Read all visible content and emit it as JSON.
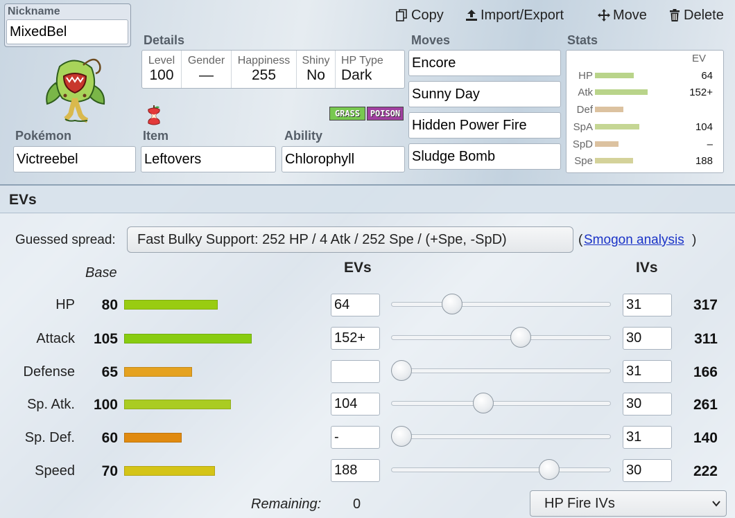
{
  "toolbar": {
    "copy_label": "Copy",
    "import_export_label": "Import/Export",
    "move_label": "Move",
    "delete_label": "Delete"
  },
  "nickname": {
    "label": "Nickname",
    "value": "MixedBel"
  },
  "details": {
    "label": "Details",
    "level": {
      "label": "Level",
      "value": "100"
    },
    "gender": {
      "label": "Gender",
      "value": "—"
    },
    "happiness": {
      "label": "Happiness",
      "value": "255"
    },
    "shiny": {
      "label": "Shiny",
      "value": "No"
    },
    "hptype": {
      "label": "HP Type",
      "value": "Dark"
    }
  },
  "types": [
    "GRASS",
    "POISON"
  ],
  "type_colors": {
    "grass": "#78c850",
    "poison": "#a040a0"
  },
  "pokemon": {
    "label": "Pokémon",
    "value": "Victreebel"
  },
  "item": {
    "label": "Item",
    "value": "Leftovers"
  },
  "ability": {
    "label": "Ability",
    "value": "Chlorophyll"
  },
  "moves": {
    "label": "Moves",
    "list": [
      "Encore",
      "Sunny Day",
      "Hidden Power Fire",
      "Sludge Bomb"
    ]
  },
  "stats": {
    "label": "Stats",
    "ev_header": "EV",
    "rows": [
      {
        "name": "HP",
        "ev": "64"
      },
      {
        "name": "Atk",
        "ev": "152+"
      },
      {
        "name": "Def",
        "ev": ""
      },
      {
        "name": "SpA",
        "ev": "104"
      },
      {
        "name": "SpD",
        "ev": "–"
      },
      {
        "name": "Spe",
        "ev": "188"
      }
    ]
  },
  "evs": {
    "title": "EVs",
    "guessed_spread_label": "Guessed spread:",
    "guessed_spread_value": "Fast Bulky Support: 252 HP / 4 Atk / 252 Spe / (+Spe, -SpD)",
    "smogon_paren_open": "(",
    "smogon_link": "Smogon analysis",
    "smogon_paren_close": ")",
    "base_header": "Base",
    "evs_header": "EVs",
    "ivs_header": "IVs",
    "rows": [
      {
        "label": "HP",
        "base": "80",
        "ev": "64",
        "iv": "31",
        "total": "317",
        "ev_fraction": 0.254
      },
      {
        "label": "Attack",
        "base": "105",
        "ev": "152+",
        "iv": "30",
        "total": "311",
        "ev_fraction": 0.603
      },
      {
        "label": "Defense",
        "base": "65",
        "ev": "",
        "iv": "31",
        "total": "166",
        "ev_fraction": 0
      },
      {
        "label": "Sp. Atk.",
        "base": "100",
        "ev": "104",
        "iv": "30",
        "total": "261",
        "ev_fraction": 0.413
      },
      {
        "label": "Sp. Def.",
        "base": "60",
        "ev": "-",
        "iv": "31",
        "total": "140",
        "ev_fraction": 0
      },
      {
        "label": "Speed",
        "base": "70",
        "ev": "188",
        "iv": "30",
        "total": "222",
        "ev_fraction": 0.746
      }
    ],
    "remaining_label": "Remaining:",
    "remaining_value": "0",
    "iv_preset": "HP Fire IVs"
  }
}
